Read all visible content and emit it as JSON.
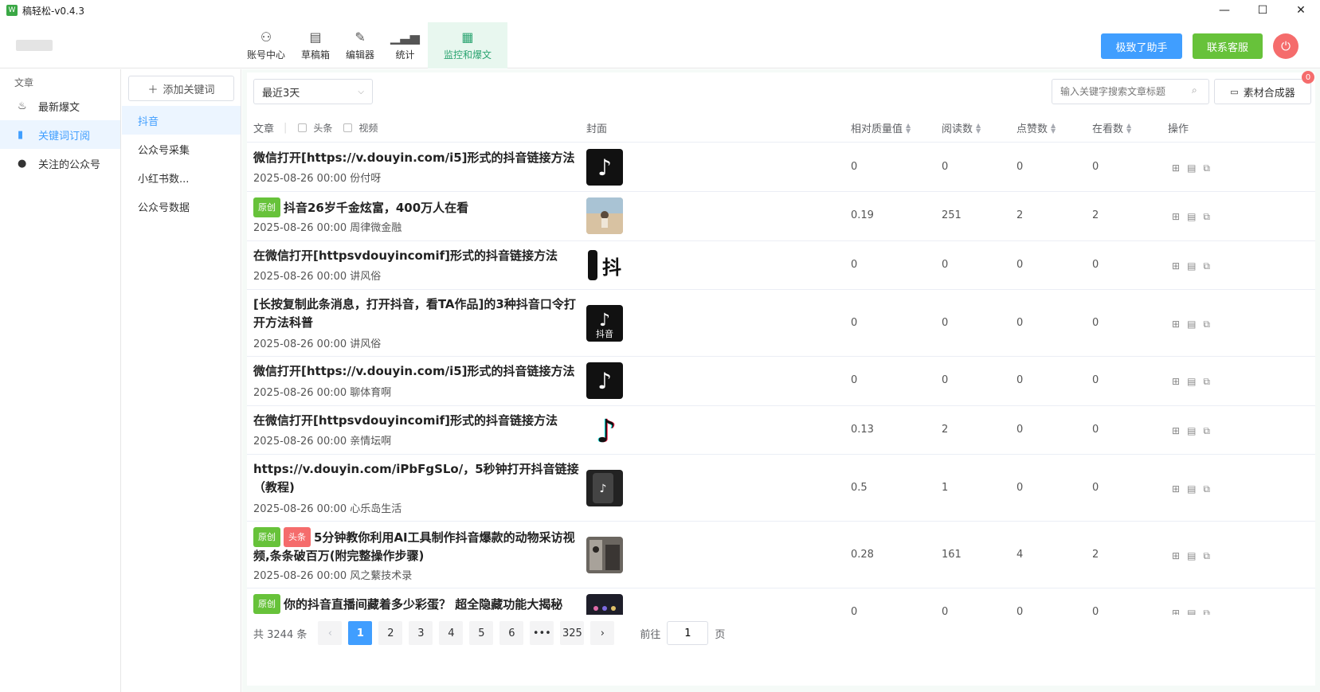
{
  "app": {
    "logo_char": "W",
    "title": "稿轻松-v0.4.3",
    "window_controls": {
      "minimize": "—",
      "maximize": "☐",
      "close": "✕"
    }
  },
  "nav": {
    "tabs": [
      {
        "label": "账号中心",
        "icon": "user-icon"
      },
      {
        "label": "草稿箱",
        "icon": "drafts-icon"
      },
      {
        "label": "编辑器",
        "icon": "pen-icon"
      },
      {
        "label": "统计",
        "icon": "chart-icon"
      },
      {
        "label": "监控和爆文",
        "icon": "document-icon",
        "active": true
      }
    ],
    "assistant_label": "极致了助手",
    "service_label": "联系客服",
    "accent": "#2ba471"
  },
  "sidebar": {
    "heading": "文章",
    "items": [
      {
        "label": "最新爆文",
        "icon": "fire-icon"
      },
      {
        "label": "关键词订阅",
        "icon": "bookmark-icon",
        "active": true
      },
      {
        "label": "关注的公众号",
        "icon": "person-icon"
      }
    ]
  },
  "keywords": {
    "add_label": "添加关键词",
    "items": [
      {
        "label": "抖音",
        "active": true
      },
      {
        "label": "公众号采集"
      },
      {
        "label": "小红书数..."
      },
      {
        "label": "公众号数据"
      }
    ]
  },
  "toolbar": {
    "date_range": "最近3天",
    "search_placeholder": "输入关键字搜索文章标题",
    "compose_label": "素材合成器",
    "compose_badge": "0"
  },
  "table": {
    "headers": {
      "article": "文章",
      "filter_headline": "头条",
      "filter_video": "视频",
      "cover": "封面",
      "quality": "相对质量值",
      "reads": "阅读数",
      "likes": "点赞数",
      "watching": "在看数",
      "actions": "操作"
    },
    "rows": [
      {
        "title": "微信打开[https://v.douyin.com/i5]形式的抖音链接方法",
        "date": "2025-08-26 00:00",
        "author": "份付呀",
        "tags": [],
        "cover": "tiktok",
        "quality": "0",
        "reads": "0",
        "likes": "0",
        "watching": "0"
      },
      {
        "title": "抖音26岁千金炫富，400万人在看",
        "date": "2025-08-26 00:00",
        "author": "周律微金融",
        "tags": [
          "原创"
        ],
        "cover": "photo",
        "quality": "0.19",
        "reads": "251",
        "likes": "2",
        "watching": "2"
      },
      {
        "title": "在微信打开[httpsvdouyincomif]形式的抖音链接方法",
        "date": "2025-08-26 00:00",
        "author": "讲风俗",
        "tags": [],
        "cover": "text-dou",
        "quality": "0",
        "reads": "0",
        "likes": "0",
        "watching": "0"
      },
      {
        "title": "[长按复制此条消息，打开抖音，看TA作品]的3种抖音口令打开方法科普",
        "date": "2025-08-26 00:00",
        "author": "讲风俗",
        "tags": [],
        "cover": "tiktok-label",
        "cover_text": "抖音",
        "quality": "0",
        "reads": "0",
        "likes": "0",
        "watching": "0"
      },
      {
        "title": "微信打开[https://v.douyin.com/i5]形式的抖音链接方法",
        "date": "2025-08-26 00:00",
        "author": "聊体育啊",
        "tags": [],
        "cover": "tiktok",
        "quality": "0",
        "reads": "0",
        "likes": "0",
        "watching": "0"
      },
      {
        "title": "在微信打开[httpsvdouyincomif]形式的抖音链接方法",
        "date": "2025-08-26 00:00",
        "author": "亲情坛啊",
        "tags": [],
        "cover": "tiktok-white",
        "quality": "0.13",
        "reads": "2",
        "likes": "0",
        "watching": "0"
      },
      {
        "title": "https://v.douyin.com/iPbFgSLo/，5秒钟打开抖音链接（教程)",
        "date": "2025-08-26 00:00",
        "author": "心乐岛生活",
        "tags": [],
        "cover": "dark-phone",
        "quality": "0.5",
        "reads": "1",
        "likes": "0",
        "watching": "0"
      },
      {
        "title": "5分钟教你利用AI工具制作抖音爆款的动物采访视频,条条破百万(附完整操作步骤)",
        "date": "2025-08-26 00:00",
        "author": "风之蘩技术录",
        "tags": [
          "原创",
          "头条"
        ],
        "cover": "room",
        "quality": "0.28",
        "reads": "161",
        "likes": "4",
        "watching": "2"
      },
      {
        "title": "你的抖音直播间藏着多少彩蛋？ 超全隐藏功能大揭秘",
        "date": "",
        "author": "",
        "tags": [
          "原创"
        ],
        "cover": "live",
        "quality": "0",
        "reads": "0",
        "likes": "0",
        "watching": "0"
      }
    ]
  },
  "pagination": {
    "total_text": "共 3244 条",
    "prev": "‹",
    "next": "›",
    "pages": [
      "1",
      "2",
      "3",
      "4",
      "5",
      "6",
      "•••",
      "325"
    ],
    "current_page": "1",
    "goto_label": "前往",
    "goto_value": "1",
    "goto_suffix": "页"
  }
}
